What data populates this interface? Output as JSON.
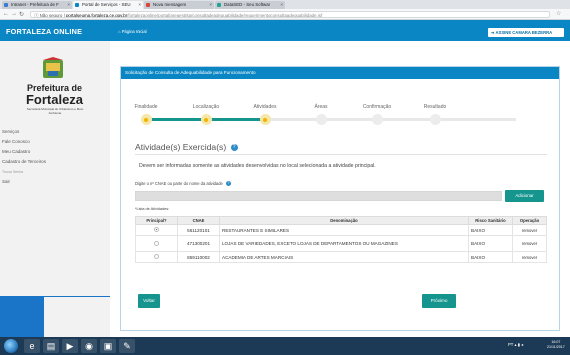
{
  "browser": {
    "tabs": [
      {
        "label": "Intranet - Prefeitura de F",
        "favicon_color": "#3b7bd1"
      },
      {
        "label": "Portal de Serviços - SEU",
        "favicon_color": "#0b86c4"
      },
      {
        "label": "Nova mensagem",
        "favicon_color": "#d9453b"
      },
      {
        "label": "DataSED - Seu Softwar",
        "favicon_color": "#2aa198"
      }
    ],
    "secure_label": "Não seguro",
    "url_host": "portalseuma.fortaleza.ce.gov.br",
    "url_path": "/fortalezaonline/portal/areaestrita/consultadeadequabilidade/requerimentoconsultaadequabilidade.jsf"
  },
  "header": {
    "brand": "FORTALEZA ONLINE",
    "home_label": "Página Inicial",
    "exit_button": "ASSINE CAMARA BEZERRA"
  },
  "sidebar": {
    "prefeitura_line1": "Prefeitura de",
    "prefeitura_line2": "Fortaleza",
    "prefeitura_sub": "Secretaria Municipal do Urbanismo e Meio Ambiente",
    "items": [
      {
        "label": "Serviços"
      },
      {
        "label": "Fale Conosco"
      },
      {
        "label": "Meu Cadastro"
      },
      {
        "label": "Cadastro de Terceiros"
      },
      {
        "label": "Trocar Senha"
      },
      {
        "label": "Sair"
      }
    ]
  },
  "card": {
    "title": "Solicitação de Consulta de Adequabilidade para Funcionamento"
  },
  "stepper": {
    "steps": [
      {
        "label": "Finalidade",
        "done": true
      },
      {
        "label": "Localização",
        "done": true
      },
      {
        "label": "Atividades",
        "done": true
      },
      {
        "label": "Áreas",
        "done": false
      },
      {
        "label": "Confirmação",
        "done": false
      },
      {
        "label": "Resultado",
        "done": false
      }
    ]
  },
  "activities": {
    "title": "Atividade(s) Exercida(s)",
    "description": "Devem ser informadas somente as atividades desenvolvidas no local selecionada a atividade principal.",
    "cnae_label": "Digite o nº CNAE ou parte do nome da atividade",
    "cnae_value": "",
    "add_button": "Adicionar",
    "list_label": "*Lista de Atividades:",
    "columns": [
      "Principal?",
      "CNAE",
      "Denominação",
      "Risco Sanitário",
      "Operação"
    ],
    "rows": [
      {
        "principal": true,
        "cnae": "561120101",
        "denominacao": "RESTAURANTES E SIMILARES",
        "risco": "BAIXO",
        "operacao": "remover"
      },
      {
        "principal": false,
        "cnae": "471300201",
        "denominacao": "LOJAS DE VARIEDADES, EXCETO LOJAS DE DEPARTAMENTOS OU MAGAZINES",
        "risco": "BAIXO",
        "operacao": "remover"
      },
      {
        "principal": false,
        "cnae": "859110002",
        "denominacao": "ACADEMIA DE ARTES MARCIAIS",
        "risco": "BAIXO",
        "operacao": "remover"
      }
    ]
  },
  "nav": {
    "back": "Voltar",
    "next": "Próximo"
  },
  "taskbar": {
    "tray_text": "PT",
    "time": "16:07",
    "date": "21/11/2017"
  },
  "colors": {
    "brand_blue": "#0b86c4",
    "accent_teal": "#16958f",
    "step_done": "#f0b400"
  }
}
